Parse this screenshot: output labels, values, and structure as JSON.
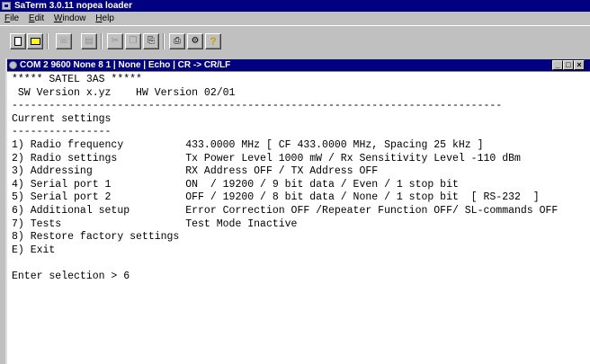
{
  "app": {
    "title": "SaTerm 3.0.11 nopea loader"
  },
  "menu": [
    {
      "prefix": "",
      "underline": "F",
      "rest": "ile"
    },
    {
      "prefix": "",
      "underline": "E",
      "rest": "dit"
    },
    {
      "prefix": "",
      "underline": "W",
      "rest": "indow"
    },
    {
      "prefix": "",
      "underline": "H",
      "rest": "elp"
    }
  ],
  "toolbar": {
    "icons": [
      "new-file-icon",
      "open-file-icon",
      "connect-icon",
      "disconnect-icon",
      "cut-icon",
      "copy-icon",
      "paste-icon",
      "print-icon",
      "settings-icon",
      "help-icon"
    ]
  },
  "child_window": {
    "title": "COM 2 9600 None  8 1 | None | Echo | CR -> CR/LF",
    "min_label": "_",
    "max_label": "□",
    "close_label": "×"
  },
  "terminal_lines": [
    "***** SATEL 3AS *****",
    " SW Version x.yz    HW Version 02/01",
    "-------------------------------------------------------------------------------",
    "Current settings",
    "----------------",
    "1) Radio frequency          433.0000 MHz [ CF 433.0000 MHz, Spacing 25 kHz ]",
    "2) Radio settings           Tx Power Level 1000 mW / Rx Sensitivity Level -110 dBm",
    "3) Addressing               RX Address OFF / TX Address OFF",
    "4) Serial port 1            ON  / 19200 / 9 bit data / Even / 1 stop bit",
    "5) Serial port 2            OFF / 19200 / 8 bit data / None / 1 stop bit  [ RS-232  ]",
    "6) Additional setup         Error Correction OFF /Repeater Function OFF/ SL-commands OFF",
    "7) Tests                    Test Mode Inactive",
    "8) Restore factory settings",
    "E) Exit",
    "",
    "Enter selection > 6"
  ]
}
